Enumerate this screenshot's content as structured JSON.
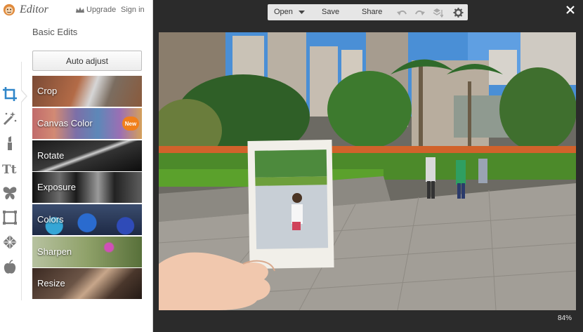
{
  "app": {
    "brand": "Editor",
    "upgrade_label": "Upgrade",
    "signin_label": "Sign in"
  },
  "panel": {
    "title": "Basic Edits",
    "auto_adjust_label": "Auto adjust",
    "items": [
      {
        "label": "Crop"
      },
      {
        "label": "Canvas Color",
        "badge": "New"
      },
      {
        "label": "Rotate"
      },
      {
        "label": "Exposure"
      },
      {
        "label": "Colors"
      },
      {
        "label": "Sharpen"
      },
      {
        "label": "Resize"
      }
    ]
  },
  "tools": [
    "crop-icon",
    "magic-wand-icon",
    "lipstick-icon",
    "text-icon",
    "butterfly-icon",
    "frame-icon",
    "texture-icon",
    "apple-icon"
  ],
  "toolbar": {
    "open_label": "Open",
    "save_label": "Save",
    "share_label": "Share"
  },
  "canvas": {
    "zoom": "84%"
  },
  "colors": {
    "accent": "#f07f1b",
    "panel_bg": "#ffffff",
    "workspace_bg": "#2b2b2b",
    "icon_gray": "#7a7a7a"
  }
}
